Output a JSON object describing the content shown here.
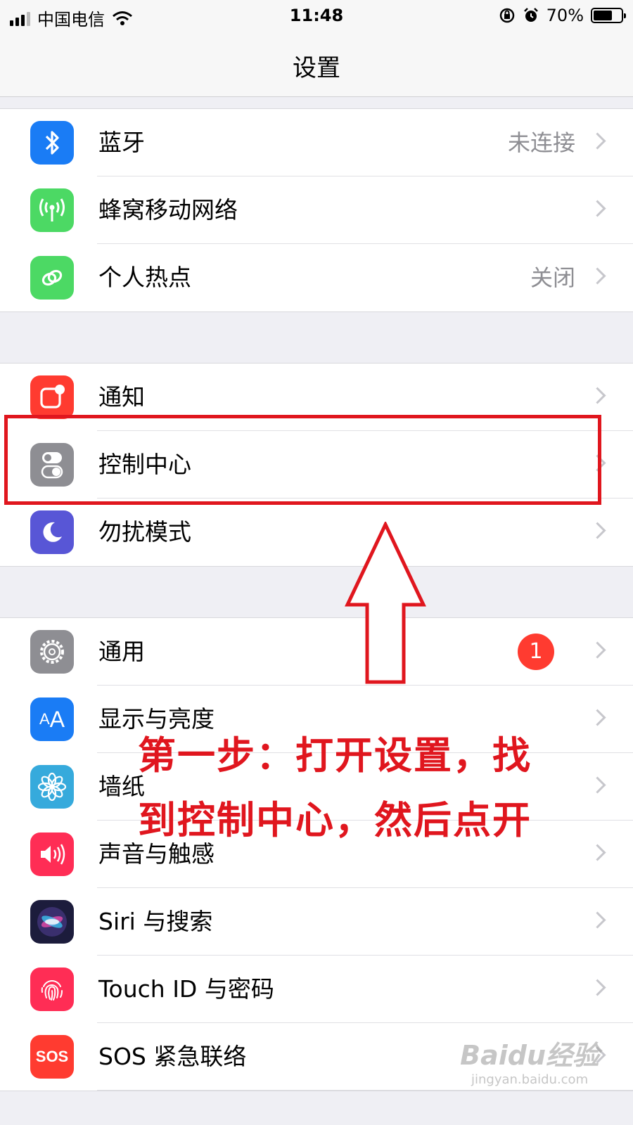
{
  "status_bar": {
    "carrier": "中国电信",
    "time": "11:48",
    "battery": "70%",
    "battery_level": 0.7
  },
  "navbar": {
    "title": "设置"
  },
  "groups": [
    [
      {
        "label": "蓝牙",
        "value": "未连接",
        "icon": "bluetooth-icon",
        "color": "#1a7cf5"
      },
      {
        "label": "蜂窝移动网络",
        "value": "",
        "icon": "antenna-icon",
        "color": "#4cd964"
      },
      {
        "label": "个人热点",
        "value": "关闭",
        "icon": "hotspot-link-icon",
        "color": "#4cd964"
      }
    ],
    [
      {
        "label": "通知",
        "value": "",
        "icon": "notifications-icon",
        "color": "#ff3b30"
      },
      {
        "label": "控制中心",
        "value": "",
        "icon": "toggles-icon",
        "color": "#8e8e93"
      },
      {
        "label": "勿扰模式",
        "value": "",
        "icon": "moon-icon",
        "color": "#5856d6"
      }
    ],
    [
      {
        "label": "通用",
        "value": "",
        "badge": "1",
        "icon": "gear-icon",
        "color": "#8e8e93"
      },
      {
        "label": "显示与亮度",
        "value": "",
        "icon": "text-size-icon",
        "color": "#1a7cf5"
      },
      {
        "label": "墙纸",
        "value": "",
        "icon": "flower-icon",
        "color": "#36aadc"
      },
      {
        "label": "声音与触感",
        "value": "",
        "icon": "speaker-icon",
        "color": "#ff2d55"
      },
      {
        "label": "Siri 与搜索",
        "value": "",
        "icon": "siri-icon",
        "color": "#1c1c3c"
      },
      {
        "label": "Touch ID 与密码",
        "value": "",
        "icon": "fingerprint-icon",
        "color": "#ff2d55"
      },
      {
        "label": "SOS 紧急联络",
        "value": "",
        "icon": "sos-icon",
        "color": "#ff3b30"
      }
    ]
  ],
  "annotation": {
    "line1": "第一步：打开设置，找",
    "line2": "到控制中心，然后点开",
    "color": "#e0161e"
  },
  "watermark": {
    "brand": "Baidu经验",
    "url": "jingyan.baidu.com"
  }
}
